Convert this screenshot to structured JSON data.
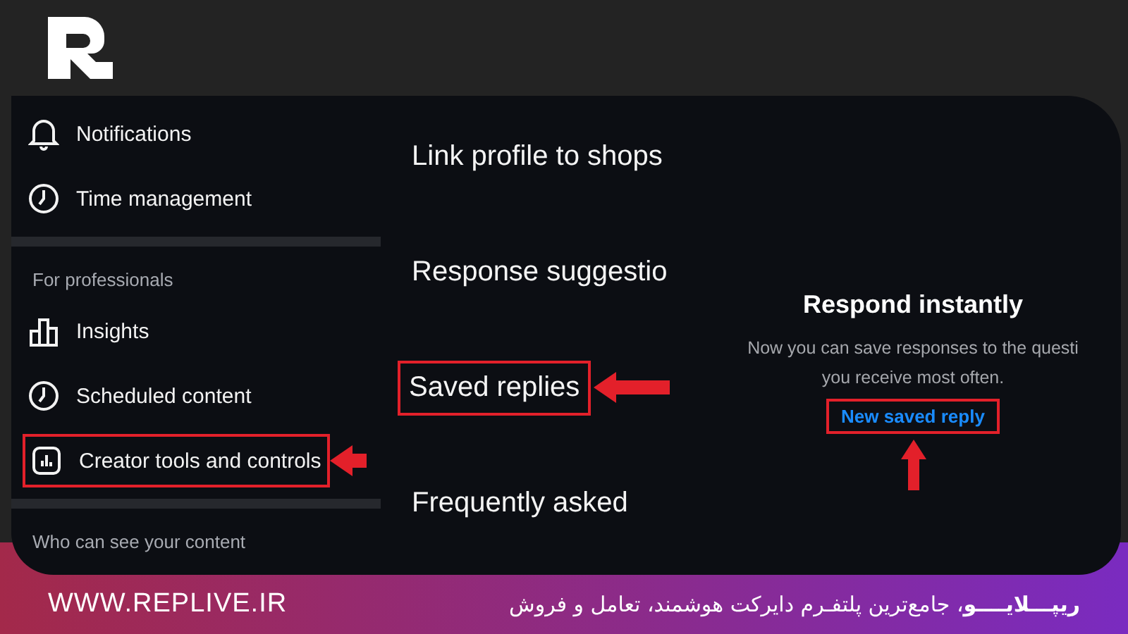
{
  "sidebar": {
    "items": [
      {
        "kind": "link",
        "label": "Notifications",
        "highlighted": false
      },
      {
        "kind": "link",
        "label": "Time management",
        "highlighted": false
      },
      {
        "kind": "divider"
      },
      {
        "kind": "heading",
        "label": "For professionals"
      },
      {
        "kind": "link",
        "label": "Insights",
        "highlighted": false
      },
      {
        "kind": "link",
        "label": "Scheduled content",
        "highlighted": false
      },
      {
        "kind": "link",
        "label": "Creator tools and controls",
        "highlighted": true
      },
      {
        "kind": "divider"
      },
      {
        "kind": "heading",
        "label": "Who can see your content"
      }
    ]
  },
  "menu": {
    "items": [
      {
        "label": "Link profile to shops",
        "highlighted": false
      },
      {
        "label": "Response suggestio",
        "highlighted": false
      },
      {
        "label": "Saved replies",
        "highlighted": true
      },
      {
        "label": "Frequently asked",
        "highlighted": false
      }
    ]
  },
  "empty_state": {
    "title": "Respond instantly",
    "body": "Now you can save responses to the questi you receive most often.",
    "link": {
      "label": "New saved reply",
      "highlighted": true
    }
  },
  "footer": {
    "website": "WWW.REPLIVE.IR",
    "tagline": "**ریپـــلایــــو**، جامع‌ترین پلتفـرم دایرکت هوشمند، تعامل و فروش"
  }
}
